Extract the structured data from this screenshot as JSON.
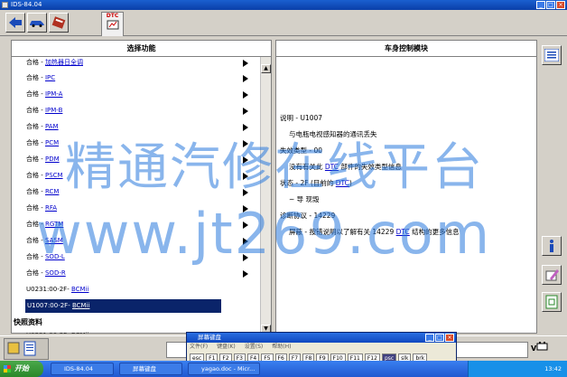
{
  "window": {
    "title": "IDS-84.04"
  },
  "toolbar": {
    "dtc_tab": "DTC"
  },
  "left_panel": {
    "header": "选择功能",
    "rows": [
      {
        "prefix": "合格 - ",
        "tag": "加热器日全调"
      },
      {
        "prefix": "合格 - ",
        "tag": "IPC"
      },
      {
        "prefix": "合格 - ",
        "tag": "IPM-A"
      },
      {
        "prefix": "合格 - ",
        "tag": "IPM-B"
      },
      {
        "prefix": "合格 - ",
        "tag": "PAM"
      },
      {
        "prefix": "合格 - ",
        "tag": "PCM"
      },
      {
        "prefix": "合格 - ",
        "tag": "PDM"
      },
      {
        "prefix": "合格 - ",
        "tag": "PSCM"
      },
      {
        "prefix": "合格 - ",
        "tag": "RCM"
      },
      {
        "prefix": "合格 - ",
        "tag": "RFA"
      },
      {
        "prefix": "合格 - ",
        "tag": "RGTM"
      },
      {
        "prefix": "合格 - ",
        "tag": "SASM"
      },
      {
        "prefix": "合格 - ",
        "tag": "SOD-L"
      },
      {
        "prefix": "合格 - ",
        "tag": "SOD-R"
      },
      {
        "prefix": "U0231:00-2F- ",
        "tag": "BCMii"
      },
      {
        "prefix": "U1007:00-2F- ",
        "tag": "BCMii"
      }
    ],
    "section": "快照资料",
    "partial_row": "U0231:00-2F- BCMii"
  },
  "right_panel": {
    "header": "车身控制模块",
    "lines": {
      "l1": "说明 - U1007",
      "l2": "与电瓶电视感知器的通讯丢失",
      "l3": "失效类型 - 00",
      "l4a": "没有有关此 ",
      "l4tag": "DTC",
      "l4b": " 部件的失效类型信息",
      "l5a": "状态 - 2F (目前的 ",
      "l5tag": "DTC",
      "l5b": ")",
      "l6": "~ 导      现毁",
      "l7": "诊断协议 - 14229",
      "l8a": "屏蔽 - 按错说明以了解有关 14229 ",
      "l8tag": "DTC",
      "l8b": " 结构的更多信息"
    }
  },
  "keyboard": {
    "title": "屏幕键盘",
    "menu": [
      "文件(F)",
      "键盘(K)",
      "设置(S)",
      "帮助(H)"
    ],
    "keys": [
      "esc",
      "F1",
      "F2",
      "F3",
      "F4",
      "F5",
      "F6",
      "F7",
      "F8",
      "F9",
      "F10",
      "F11",
      "F12",
      "psc",
      "slk",
      "brk"
    ]
  },
  "statusbar": {
    "vbat_label": "V"
  },
  "taskbar": {
    "start": "开始",
    "tasks": [
      "IDS-84.04",
      "屏幕键盘",
      "yagao.doc - Micr..."
    ],
    "clock": "13:42"
  },
  "watermark": {
    "line1": "精通汽修在线平台",
    "line2": "www.jt269.com"
  }
}
